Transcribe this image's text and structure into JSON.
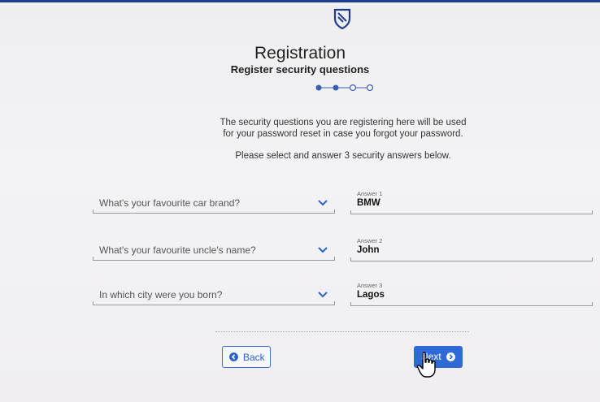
{
  "header": {
    "title": "Registration",
    "subtitle": "Register security questions"
  },
  "stepper": {
    "total_steps": 4,
    "completed_steps": 2
  },
  "intro": {
    "line1": "The security questions you are registering here will be used",
    "line2": "for your password reset in case you forgot your password.",
    "instruction": "Please select and answer 3 security answers below."
  },
  "questions": [
    {
      "question": "What's your favourite car brand?",
      "answer_label": "Answer 1",
      "answer_value": "BMW"
    },
    {
      "question": "What's your favourite uncle's name?",
      "answer_label": "Answer 2",
      "answer_value": "John"
    },
    {
      "question": "In which city were you born?",
      "answer_label": "Answer 3",
      "answer_value": "Lagos"
    }
  ],
  "buttons": {
    "back_label": "Back",
    "next_label": "Next"
  },
  "icons": {
    "logo": "shield-logo-icon",
    "chevron": "chevron-down-icon",
    "back": "arrow-left-circle-icon",
    "next": "arrow-right-circle-icon",
    "cursor": "hand-pointer-cursor-icon"
  },
  "colors": {
    "brand_blue": "#2e6ad6",
    "top_bar": "#1e3b8c",
    "stepper": "#3a5fb0"
  }
}
